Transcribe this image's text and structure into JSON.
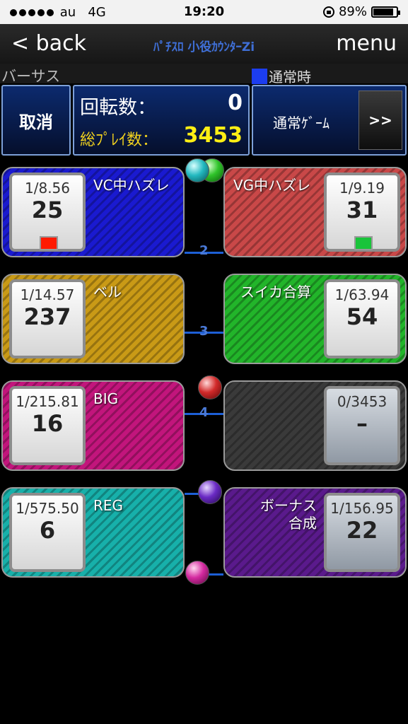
{
  "status_bar": {
    "carrier": "au",
    "network": "4G",
    "time": "19:20",
    "battery": "89%",
    "battery_level": 0.89
  },
  "nav": {
    "back": "< back",
    "title": "ﾊﾟﾁｽﾛ 小役ｶｳﾝﾀｰZi",
    "menu": "menu"
  },
  "sub": {
    "versus": "バーサス",
    "mode_indicator": "通常時",
    "mode_color": "#1c3df0"
  },
  "controls": {
    "cancel": "取消",
    "rotations_label": "回転数：",
    "rotations_value": "0",
    "total_label": "総ﾌﾟﾚｲ数：",
    "total_value": "3453",
    "mode_label": "通常ｹﾞｰﾑ",
    "next_label": ">>"
  },
  "panels": [
    {
      "label": "VC中ハズレ",
      "prob": "1/8.56",
      "count": "25",
      "flag_color": "#ff1a00",
      "color": "#1a1ad0"
    },
    {
      "label": "VG中ハズレ",
      "prob": "1/9.19",
      "count": "31",
      "flag_color": "#19c43a",
      "color": "#c94848"
    },
    {
      "label": "ベル",
      "prob": "1/14.57",
      "count": "237",
      "color": "#c99a16"
    },
    {
      "label": "スイカ合算",
      "prob": "1/63.94",
      "count": "54",
      "color": "#22b52a"
    },
    {
      "label": "BIG",
      "prob": "1/215.81",
      "count": "16",
      "color": "#c2157c"
    },
    {
      "label": "",
      "prob": "0/3453",
      "count": "–",
      "color": "#3a3a3a"
    },
    {
      "label": "REG",
      "prob": "1/575.50",
      "count": "6",
      "color": "#17b0aa"
    },
    {
      "label": "ボーナス合成",
      "label_line1": "ボーナス",
      "label_line2": "合成",
      "prob": "1/156.95",
      "count": "22",
      "color": "#5a1a8c"
    }
  ],
  "connectors": [
    "2",
    "3",
    "4"
  ]
}
